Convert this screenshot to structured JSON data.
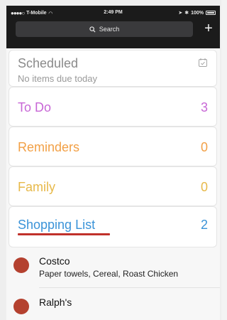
{
  "status_bar": {
    "carrier": "T-Mobile",
    "time": "2:49 PM",
    "battery": "100%"
  },
  "header": {
    "search_label": "Search",
    "add_label": "+"
  },
  "lists": {
    "scheduled": {
      "title": "Scheduled",
      "subtitle": "No items due today"
    },
    "todo": {
      "title": "To Do",
      "count": "3",
      "color": "#c867d6"
    },
    "reminders": {
      "title": "Reminders",
      "count": "0",
      "color": "#f2a046"
    },
    "family": {
      "title": "Family",
      "count": "0",
      "color": "#e7b94a"
    },
    "shopping": {
      "title": "Shopping List",
      "count": "2",
      "color": "#3a93d8"
    }
  },
  "shopping_items": [
    {
      "name": "Costco",
      "desc": "Paper towels, Cereal, Roast Chicken"
    },
    {
      "name": "Ralph's",
      "desc": ""
    }
  ],
  "colors": {
    "header_bg": "#1b1b1b",
    "item_dot": "#b4412f",
    "underline": "#c0312b"
  }
}
